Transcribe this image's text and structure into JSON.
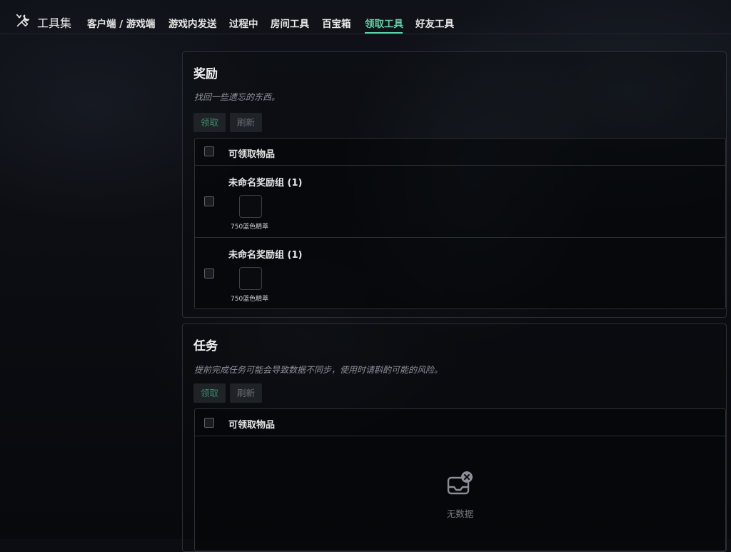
{
  "nav": {
    "brand": "工具集",
    "items": [
      "客户端 / 游戏端",
      "游戏内发送",
      "过程中",
      "房间工具",
      "百宝箱",
      "领取工具",
      "好友工具"
    ],
    "active_index": 5,
    "brand_icon": "tools-icon",
    "accent_color": "#5fd3a8"
  },
  "rewards": {
    "title": "奖励",
    "description": "找回一些遗忘的东西。",
    "claim_label": "领取",
    "refresh_label": "刷新",
    "table_header": "可领取物品",
    "rows": [
      {
        "group": "未命名奖励组 (1)",
        "item": "750蓝色精萃"
      },
      {
        "group": "未命名奖励组 (1)",
        "item": "750蓝色精萃"
      }
    ]
  },
  "missions": {
    "title": "任务",
    "description": "提前完成任务可能会导致数据不同步，使用时请斟酌可能的风险。",
    "claim_label": "领取",
    "refresh_label": "刷新",
    "table_header": "可领取物品",
    "empty_text": "无数据",
    "empty_icon": "empty-inbox-icon"
  }
}
